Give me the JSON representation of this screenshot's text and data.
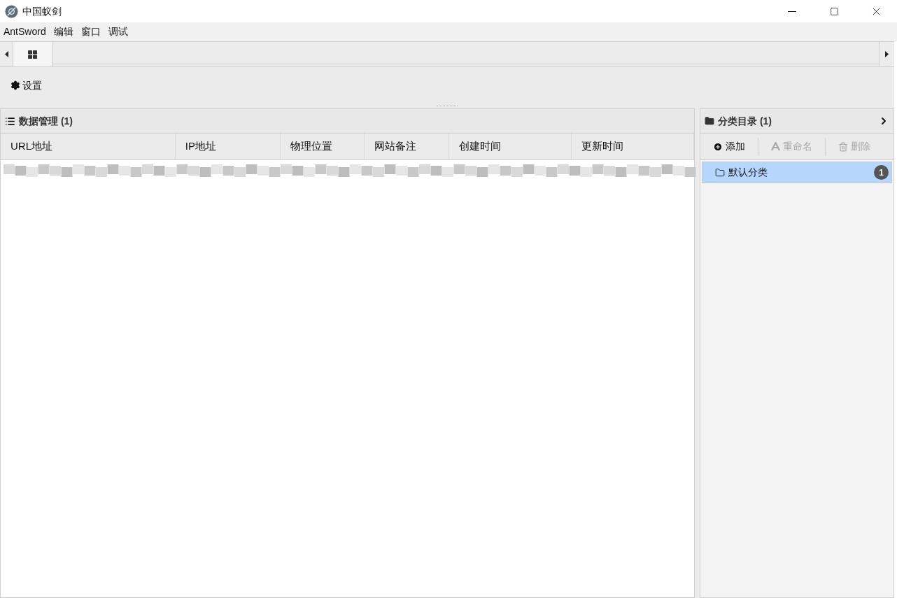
{
  "window": {
    "title": "中国蚁剑"
  },
  "menu": [
    "AntSword",
    "编辑",
    "窗口",
    "调试"
  ],
  "toolbar": [
    {
      "label": "设置"
    }
  ],
  "data_panel": {
    "title": "数据管理 (1)",
    "columns": [
      "URL地址",
      "IP地址",
      "物理位置",
      "网站备注",
      "创建时间",
      "更新时间"
    ]
  },
  "category_panel": {
    "title": "分类目录 (1)",
    "actions": [
      {
        "kind": "add",
        "label": "添加",
        "disabled": false
      },
      {
        "kind": "rename",
        "label": "重命名",
        "disabled": true
      },
      {
        "kind": "delete",
        "label": "删除",
        "disabled": true
      }
    ],
    "items": [
      {
        "label": "默认分类",
        "count": "1",
        "selected": true
      }
    ]
  }
}
